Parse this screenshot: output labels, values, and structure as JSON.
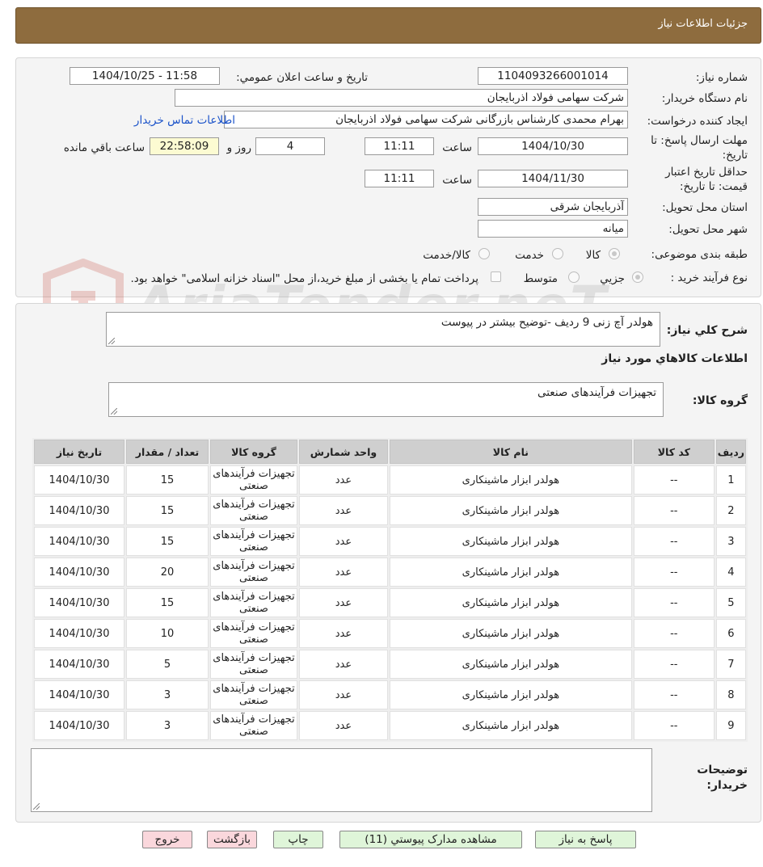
{
  "header": {
    "title": "جزئیات اطلاعات نیاز"
  },
  "watermark": {
    "brand": "AriaTender.neT"
  },
  "form": {
    "need_number_label": "شماره نیاز:",
    "need_number": "1104093266001014",
    "announce_label": "تاریخ و ساعت اعلان عمومي:",
    "announce_value": "1404/10/25 - 11:58",
    "buyer_org_label": "نام دستگاه خريدار:",
    "buyer_org": "شرکت سهامی فولاد اذربایجان",
    "requester_label": "ایجاد کننده درخواست:",
    "requester": "بهرام محمدی کارشناس بازرگانی شرکت سهامی فولاد اذربایجان",
    "contact_link": "اطلاعات تماس خریدار",
    "deadline_label": "مهلت ارسال پاسخ: تا تاریخ:",
    "deadline_date": "1404/10/30",
    "time_label": "ساعت",
    "deadline_time": "11:11",
    "days_value": "4",
    "days_label": "روز و",
    "remaining_time": "22:58:09",
    "remaining_label": "ساعت باقي مانده",
    "validity_label": "حداقل تاریخ اعتبار قیمت: تا تاریخ:",
    "validity_date": "1404/11/30",
    "validity_time": "11:11",
    "province_label": "استان محل تحویل:",
    "province": "آذربایجان شرقی",
    "city_label": "شهر محل تحویل:",
    "city": "میانه",
    "category_label": "طبقه بندی موضوعی:",
    "category_options": [
      "کالا",
      "خدمت",
      "کالا/خدمت"
    ],
    "process_label": "نوع فرآیند خرید :",
    "process_options": [
      "جزیي",
      "متوسط"
    ],
    "payment_note": "پرداخت تمام یا بخشی از مبلغ خرید،از محل \"اسناد خزانه اسلامی\" خواهد بود."
  },
  "details": {
    "summary_label": "شرح کلي نياز:",
    "summary": "هولدر آچ زنی 9 ردیف -توضیح بیشتر در پیوست",
    "goods_info_title": "اطلاعات کالاهاي مورد نياز",
    "goods_group_label": "گروه کالا:",
    "goods_group": "تجهیزات فرآیندهای صنعتی",
    "table": {
      "headers": [
        "رديف",
        "کد کالا",
        "نام کالا",
        "واحد شمارش",
        "گروه کالا",
        "تعداد / مقدار",
        "تاريخ نياز"
      ],
      "rows": [
        [
          "1",
          "--",
          "هولدر ابزار ماشینکاری",
          "عدد",
          "تجهیزات فرآیندهای صنعتی",
          "15",
          "1404/10/30"
        ],
        [
          "2",
          "--",
          "هولدر ابزار ماشینکاری",
          "عدد",
          "تجهیزات فرآیندهای صنعتی",
          "15",
          "1404/10/30"
        ],
        [
          "3",
          "--",
          "هولدر ابزار ماشینکاری",
          "عدد",
          "تجهیزات فرآیندهای صنعتی",
          "15",
          "1404/10/30"
        ],
        [
          "4",
          "--",
          "هولدر ابزار ماشینکاری",
          "عدد",
          "تجهیزات فرآیندهای صنعتی",
          "20",
          "1404/10/30"
        ],
        [
          "5",
          "--",
          "هولدر ابزار ماشینکاری",
          "عدد",
          "تجهیزات فرآیندهای صنعتی",
          "15",
          "1404/10/30"
        ],
        [
          "6",
          "--",
          "هولدر ابزار ماشینکاری",
          "عدد",
          "تجهیزات فرآیندهای صنعتی",
          "10",
          "1404/10/30"
        ],
        [
          "7",
          "--",
          "هولدر ابزار ماشینکاری",
          "عدد",
          "تجهیزات فرآیندهای صنعتی",
          "5",
          "1404/10/30"
        ],
        [
          "8",
          "--",
          "هولدر ابزار ماشینکاری",
          "عدد",
          "تجهیزات فرآیندهای صنعتی",
          "3",
          "1404/10/30"
        ],
        [
          "9",
          "--",
          "هولدر ابزار ماشینکاری",
          "عدد",
          "تجهیزات فرآیندهای صنعتی",
          "3",
          "1404/10/30"
        ]
      ]
    },
    "buyer_notes_label": "توضیحات خریدار:"
  },
  "buttons": {
    "reply": "پاسخ به نیاز",
    "attachments": "مشاهده مدارک پیوستي (11)",
    "print": "چاپ",
    "back": "بازگشت",
    "exit": "خروج"
  },
  "colors": {
    "header_bg": "#8e6c3e",
    "link": "#1a52c9",
    "button_green": "#dff5d9",
    "button_pink": "#fad7dc"
  }
}
